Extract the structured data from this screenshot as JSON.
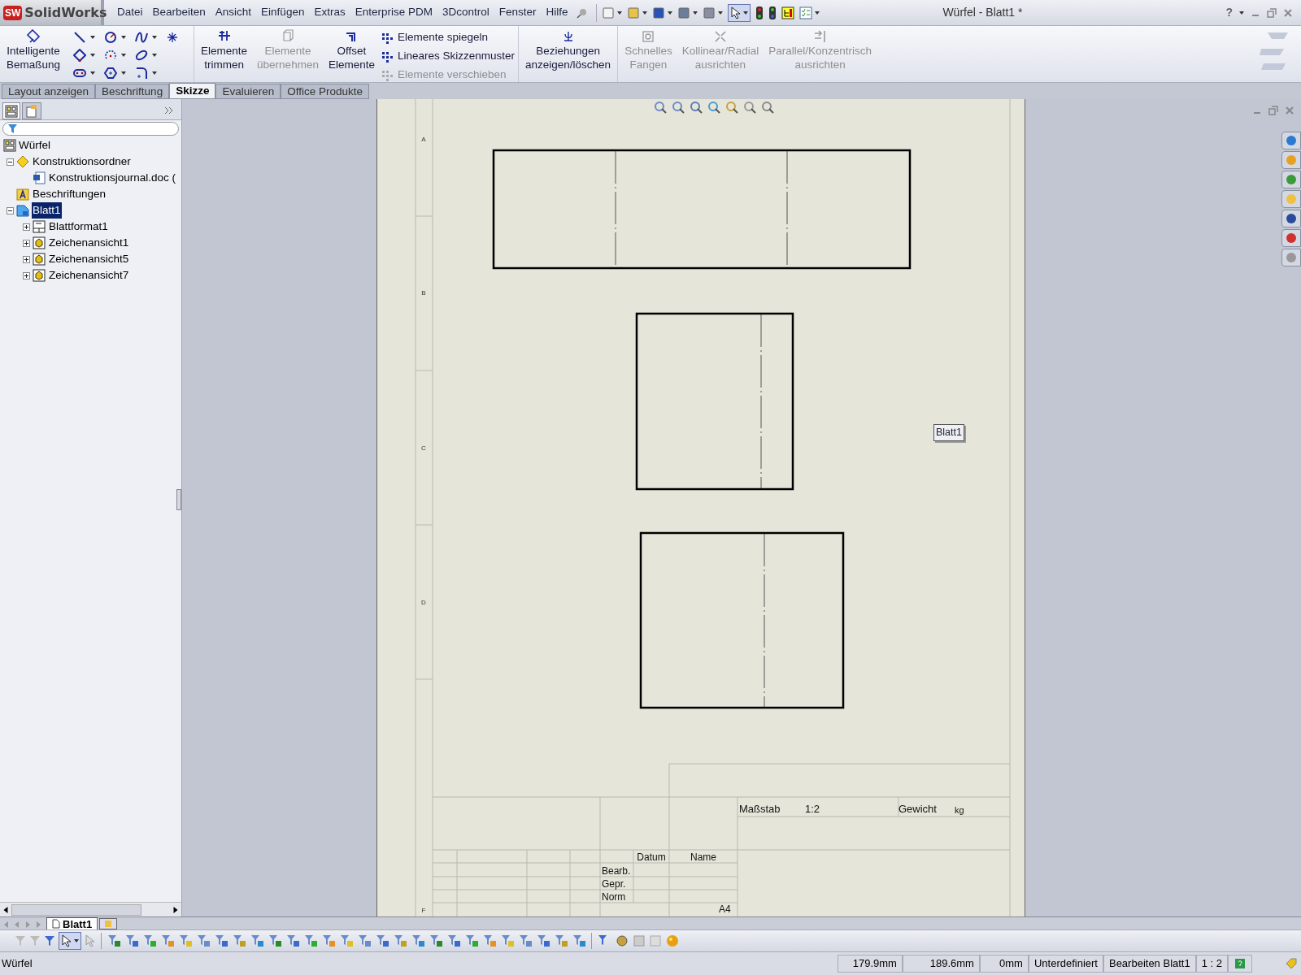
{
  "app": {
    "logo_badge": "SW",
    "logo": "SolidWorks"
  },
  "menu": [
    "Datei",
    "Bearbeiten",
    "Ansicht",
    "Einfügen",
    "Extras",
    "Enterprise PDM",
    "3Dcontrol",
    "Fenster",
    "Hilfe"
  ],
  "window": {
    "title": "Würfel - Blatt1 *",
    "help": "?"
  },
  "ribbon": {
    "groups": [
      [
        {
          "kind": "large",
          "lines": [
            "Intelligente",
            "Bemaßung"
          ],
          "disabled": false
        },
        {
          "kind": "sketch_tools"
        }
      ],
      [
        {
          "kind": "large",
          "lines": [
            "Elemente",
            "trimmen"
          ],
          "disabled": false
        },
        {
          "kind": "large",
          "lines": [
            "Elemente",
            "übernehmen"
          ],
          "disabled": true
        },
        {
          "kind": "large",
          "lines": [
            "Offset",
            "Elemente"
          ],
          "disabled": false
        },
        {
          "kind": "list",
          "entries": [
            {
              "label": "Elemente spiegeln",
              "disabled": false
            },
            {
              "label": "Lineares Skizzenmuster",
              "disabled": false
            },
            {
              "label": "Elemente verschieben",
              "disabled": true
            }
          ]
        }
      ],
      [
        {
          "kind": "large",
          "lines": [
            "Beziehungen",
            "anzeigen/löschen"
          ],
          "disabled": false
        }
      ],
      [
        {
          "kind": "large",
          "lines": [
            "Schnelles",
            "Fangen"
          ],
          "disabled": true
        },
        {
          "kind": "large",
          "lines": [
            "Kollinear/Radial",
            "ausrichten"
          ],
          "disabled": true
        },
        {
          "kind": "large",
          "lines": [
            "Parallel/Konzentrisch",
            "ausrichten"
          ],
          "disabled": true
        }
      ]
    ]
  },
  "tabs": [
    {
      "label": "Layout anzeigen",
      "selected": false
    },
    {
      "label": "Beschriftung",
      "selected": false
    },
    {
      "label": "Skizze",
      "selected": true
    },
    {
      "label": "Evaluieren",
      "selected": false
    },
    {
      "label": "Office Produkte",
      "selected": false
    }
  ],
  "tree": {
    "root": {
      "label": "Würfel",
      "kind": "part"
    },
    "items": [
      {
        "label": "Konstruktionsordner",
        "kind": "folder",
        "expanded": true,
        "selected": false,
        "children": [
          {
            "label": "Konstruktionsjournal.doc (",
            "kind": "word",
            "selected": false
          }
        ]
      },
      {
        "label": "Beschriftungen",
        "kind": "annotation",
        "selected": false
      },
      {
        "label": "Blatt1",
        "kind": "sheet",
        "expanded": true,
        "selected": true,
        "children": [
          {
            "label": "Blattformat1",
            "kind": "format",
            "expanded": false,
            "selected": false
          },
          {
            "label": "Zeichenansicht1",
            "kind": "view",
            "expanded": false,
            "selected": false
          },
          {
            "label": "Zeichenansicht5",
            "kind": "view",
            "expanded": false,
            "selected": false
          },
          {
            "label": "Zeichenansicht7",
            "kind": "view",
            "expanded": false,
            "selected": false
          }
        ]
      }
    ]
  },
  "sheet": {
    "zones": [
      "A",
      "B",
      "C",
      "D",
      "F"
    ],
    "label": "Blatt1",
    "title_block": {
      "scale_label": "Maßstab",
      "scale": "1:2",
      "weight_label": "Gewicht",
      "weight_unit": "kg",
      "date_header": "Datum",
      "name_header": "Name",
      "rows": [
        "Bearb.",
        "Gepr.",
        "Norm"
      ],
      "format": "A4"
    }
  },
  "sheet_tabs": [
    {
      "label": "Blatt1",
      "selected": true
    }
  ],
  "status_bar": {
    "document": "Würfel",
    "x": "179.9mm",
    "y": "189.6mm",
    "z": "0mm",
    "state": "Unterdefiniert",
    "mode": "Bearbeiten Blatt1",
    "scale": "1 : 2"
  }
}
